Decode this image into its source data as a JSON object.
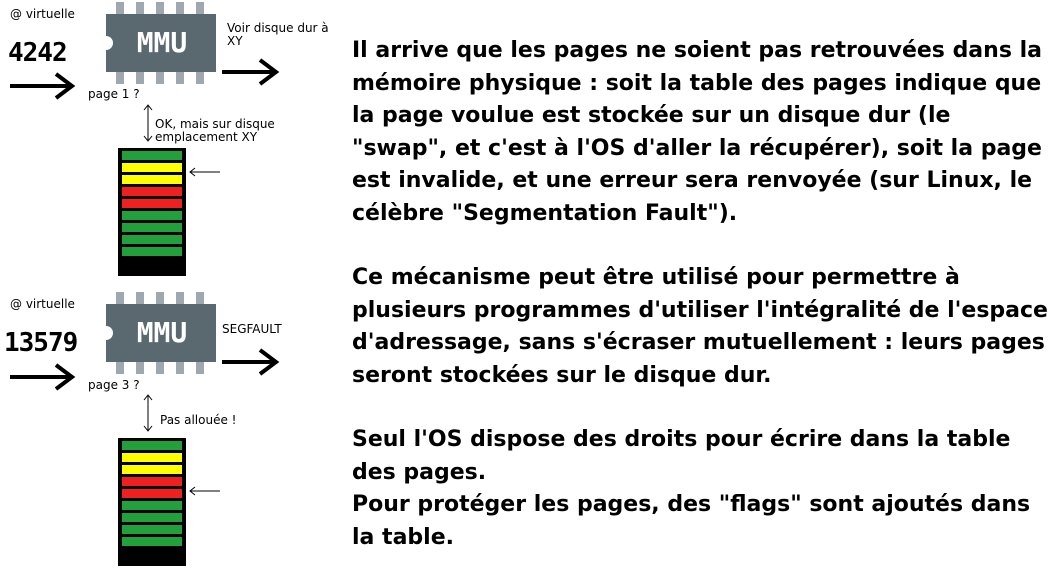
{
  "colors": {
    "green": "#22a03c",
    "yellow": "#ffff00",
    "red": "#ee2020",
    "chip": "#5a6870",
    "chip_pin": "#9ea8ae"
  },
  "diagram1": {
    "address_label": "@ virtuelle",
    "address_value": "4242",
    "chip_label": "MMU",
    "query_label": "page 1 ?",
    "answer_label": "OK, mais sur disque emplacement XY",
    "result_label": "Voir disque dur à XY",
    "page_table": [
      "green",
      "yellow",
      "yellow",
      "red",
      "red",
      "green",
      "green",
      "green",
      "green"
    ]
  },
  "diagram2": {
    "address_label": "@ virtuelle",
    "address_value": "13579",
    "chip_label": "MMU",
    "query_label": "page 3 ?",
    "answer_label": "Pas allouée !",
    "result_label": "SEGFAULT",
    "page_table": [
      "green",
      "yellow",
      "yellow",
      "red",
      "red",
      "green",
      "green",
      "green",
      "green"
    ]
  },
  "text": {
    "paragraph1": "Il arrive que les pages ne soient pas retrouvées dans la mémoire physique : soit la table des pages indique que la page voulue est stockée sur un disque dur (le \"swap\", et c'est à l'OS d'aller la récupérer), soit la page est invalide, et une erreur sera renvoyée (sur Linux, le célèbre \"Segmentation Fault\").",
    "paragraph2": "Ce mécanisme peut être utilisé pour permettre à plusieurs programmes d'utiliser l'intégralité de l'espace d'adressage, sans s'écraser mutuellement : leurs pages seront stockées sur le disque dur.",
    "paragraph3_line1": "Seul l'OS dispose des droits pour écrire dans la table des pages.",
    "paragraph3_line2": "Pour protéger les pages, des \"flags\" sont ajoutés dans la table."
  }
}
